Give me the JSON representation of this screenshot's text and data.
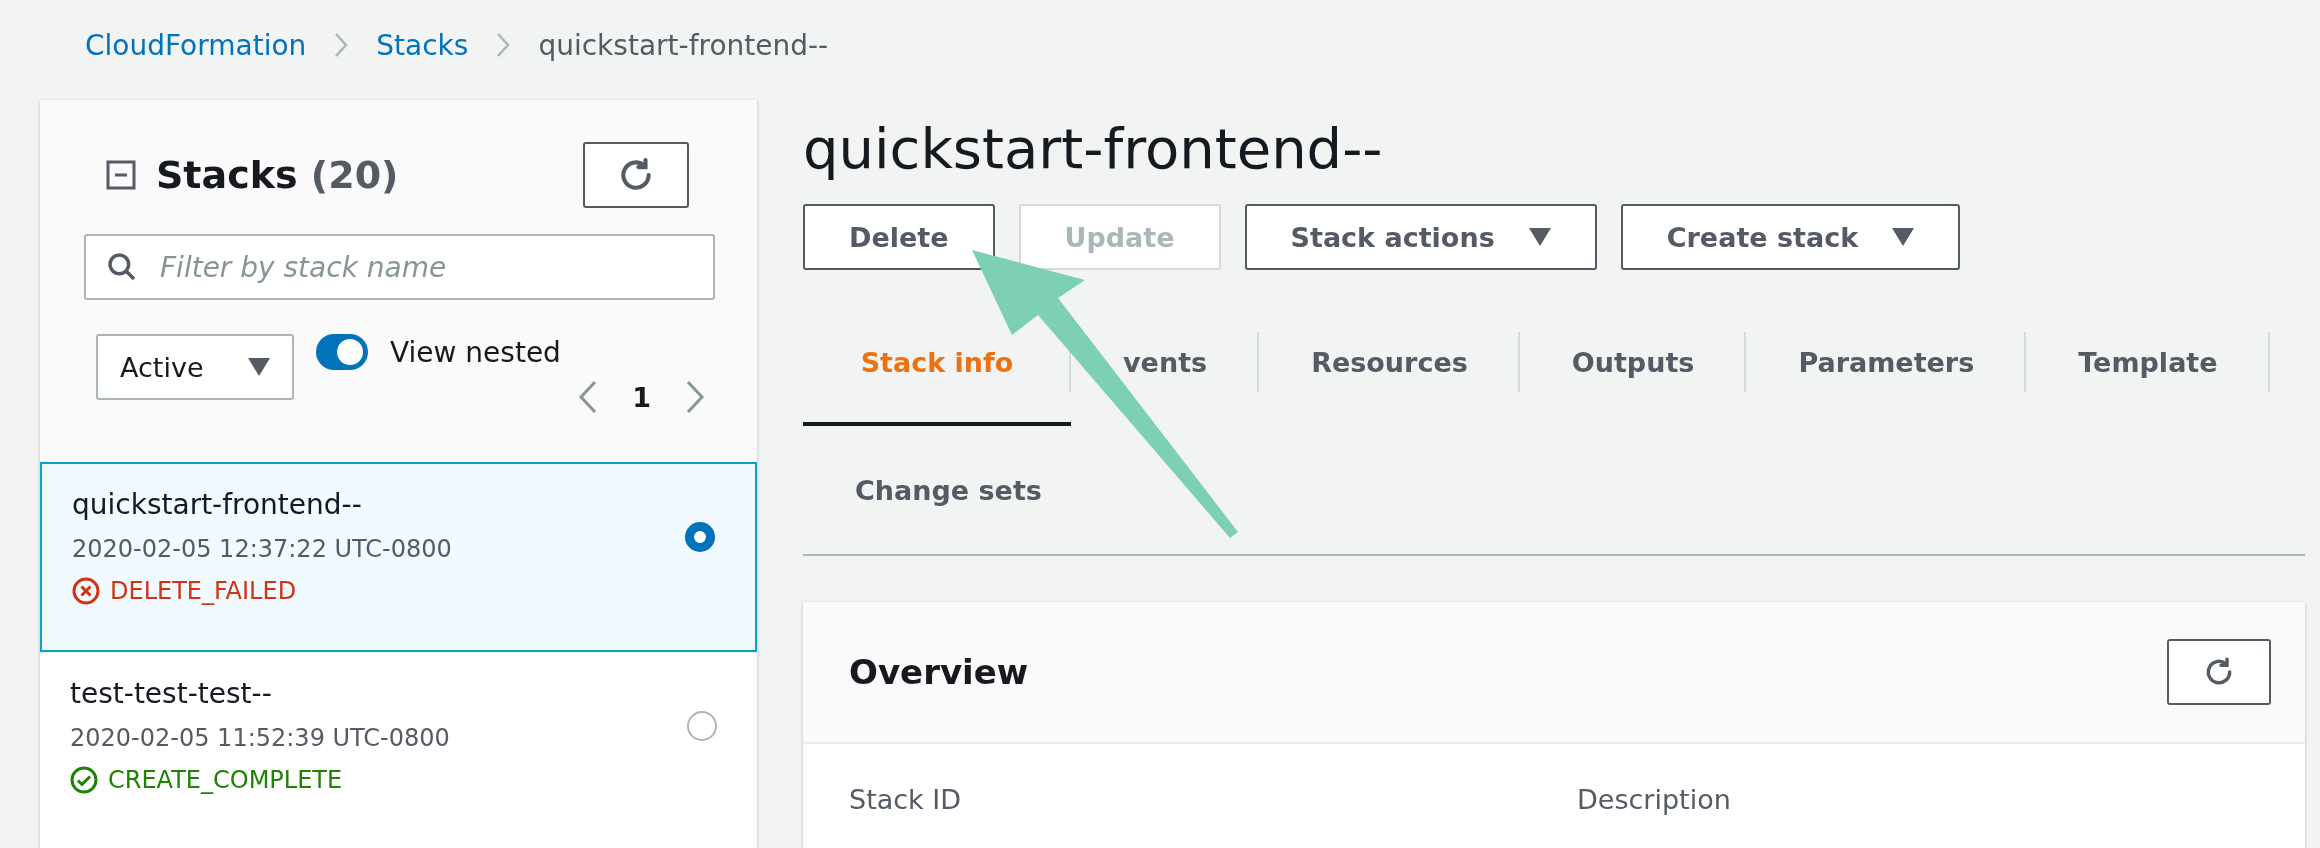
{
  "breadcrumbs": [
    {
      "label": "CloudFormation",
      "kind": "link"
    },
    {
      "label": "Stacks",
      "kind": "link"
    },
    {
      "label": "quickstart-frontend--",
      "kind": "current"
    }
  ],
  "stacks_panel": {
    "title": "Stacks",
    "count": "(20)",
    "filter": {
      "placeholder": "Filter by stack name"
    },
    "status_filter": {
      "value": "Active"
    },
    "view_nested": {
      "label": "View nested",
      "on": true
    },
    "pagination": {
      "page": "1"
    },
    "stacks": [
      {
        "name": "quickstart-frontend--",
        "time": "2020-02-05 12:37:22 UTC-0800",
        "status": "DELETE_FAILED",
        "kind": "failed",
        "selected": true
      },
      {
        "name": "test-test-test--",
        "time": "2020-02-05 11:52:39 UTC-0800",
        "status": "CREATE_COMPLETE",
        "kind": "complete",
        "selected": false
      }
    ]
  },
  "detail": {
    "title": "quickstart-frontend--",
    "actions": [
      {
        "label": "Delete",
        "disabled": false,
        "dropdown": false
      },
      {
        "label": "Update",
        "disabled": true,
        "dropdown": false
      },
      {
        "label": "Stack actions",
        "disabled": false,
        "dropdown": true
      },
      {
        "label": "Create stack",
        "disabled": false,
        "dropdown": true
      }
    ],
    "tabs": [
      {
        "label": "Stack info",
        "selected": true
      },
      {
        "label": "vents",
        "selected": false
      },
      {
        "label": "Resources",
        "selected": false
      },
      {
        "label": "Outputs",
        "selected": false
      },
      {
        "label": "Parameters",
        "selected": false
      },
      {
        "label": "Template",
        "selected": false
      },
      {
        "label": "Change sets",
        "selected": false
      }
    ],
    "overview": {
      "title": "Overview",
      "fields": [
        {
          "label": "Stack ID"
        },
        {
          "label": "Description"
        }
      ]
    }
  }
}
